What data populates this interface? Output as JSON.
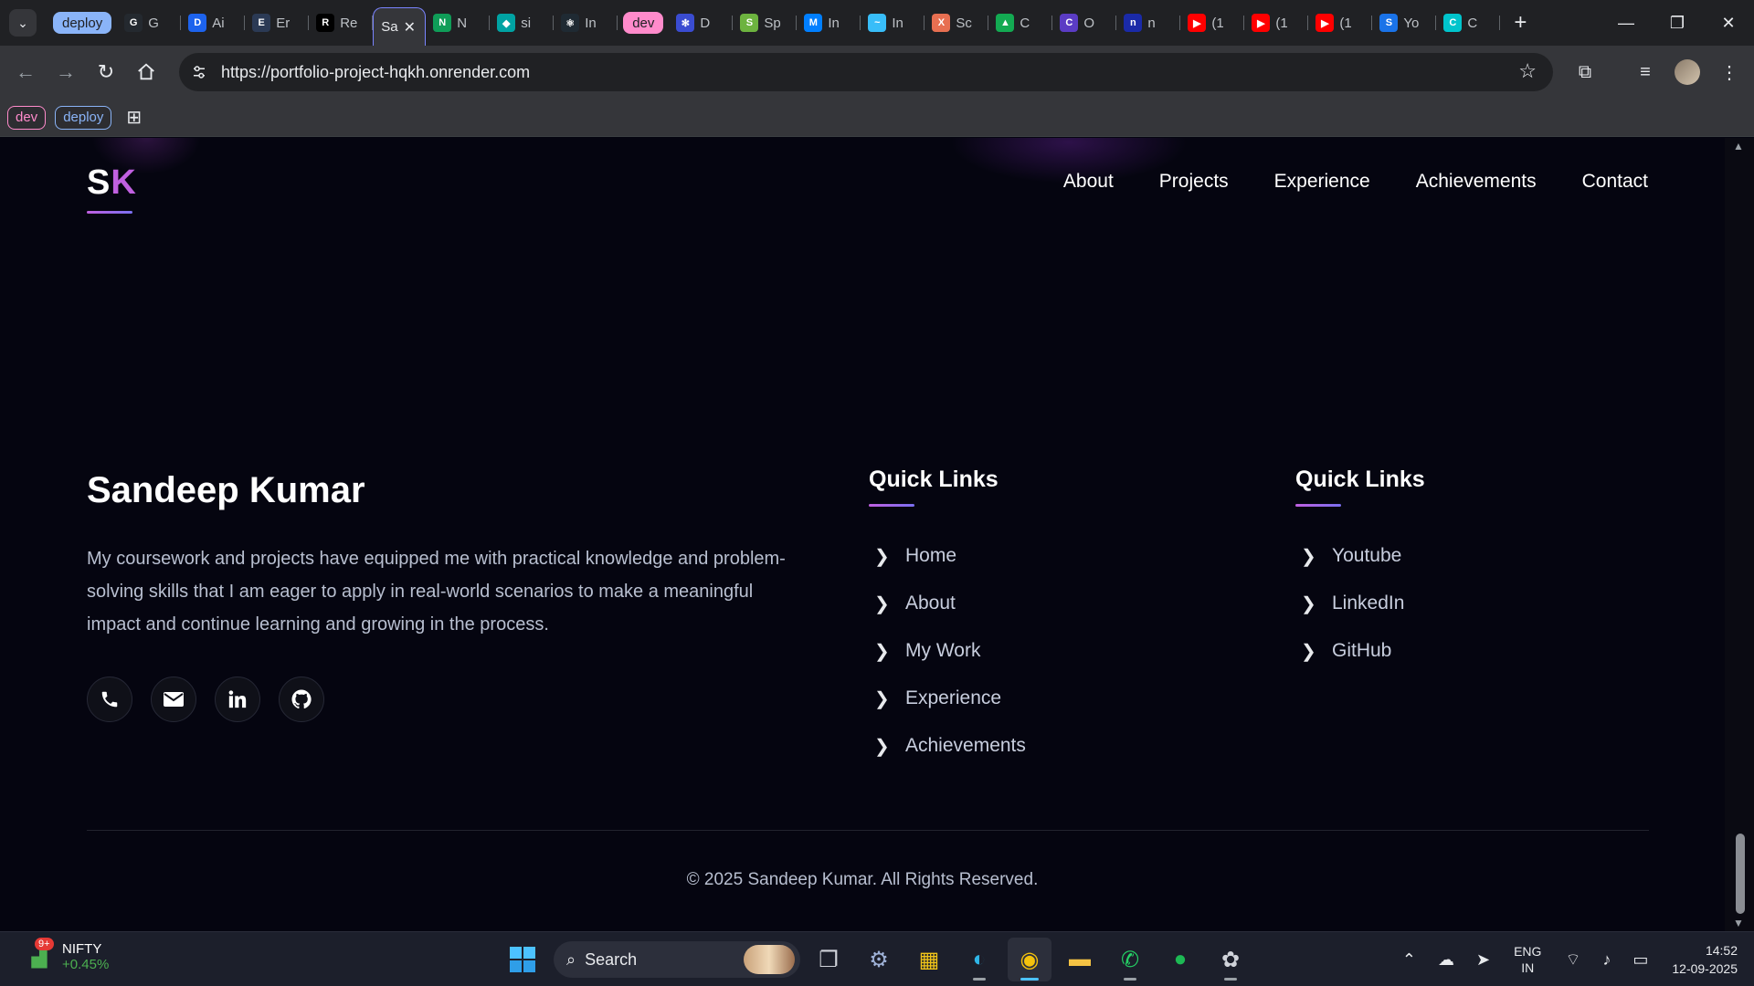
{
  "browser": {
    "tab_groups": [
      {
        "label": "deploy",
        "color": "#8ab4f8",
        "text_color": "#202124"
      },
      {
        "label": "dev",
        "color": "#ff8bcb",
        "text_color": "#202124"
      }
    ],
    "tabs_left": [
      {
        "icon": "github-icon",
        "glyph": "G",
        "bg": "#24292f",
        "title": "G"
      },
      {
        "icon": "docker-icon",
        "glyph": "D",
        "bg": "#1d63ed",
        "title": "Ai"
      },
      {
        "icon": "eraser-icon",
        "glyph": "E",
        "bg": "#2b3a55",
        "title": "Er"
      },
      {
        "icon": "render-icon",
        "glyph": "R",
        "bg": "#000000",
        "title": "Re"
      }
    ],
    "active_tab": {
      "icon": "portfolio-icon",
      "title": "Sa"
    },
    "tabs_after_active": [
      {
        "icon": "node-icon",
        "glyph": "N",
        "bg": "#0f9d58",
        "title": "N"
      },
      {
        "icon": "diamond-icon",
        "glyph": "◆",
        "bg": "#00a3a3",
        "title": "si"
      },
      {
        "icon": "react-icon",
        "glyph": "⚛",
        "bg": "#1f2a33",
        "title": "In"
      }
    ],
    "tabs_dev": [
      {
        "icon": "gear-icon",
        "glyph": "✻",
        "bg": "#3a4cd1",
        "title": "D"
      },
      {
        "icon": "spring-icon",
        "glyph": "S",
        "bg": "#6db33f",
        "title": "Sp"
      },
      {
        "icon": "mui-icon",
        "glyph": "M",
        "bg": "#007fff",
        "title": "In"
      },
      {
        "icon": "tailwind-icon",
        "glyph": "~",
        "bg": "#38bdf8",
        "title": "In"
      },
      {
        "icon": "framework-icon",
        "glyph": "X",
        "bg": "#e76f51",
        "title": "Sc"
      },
      {
        "icon": "mongo-icon",
        "glyph": "▲",
        "bg": "#13aa52",
        "title": "C"
      },
      {
        "icon": "claude-icon",
        "glyph": "C",
        "bg": "#5b3cc4",
        "title": "O"
      },
      {
        "icon": "n-icon",
        "glyph": "n",
        "bg": "#1a2aa8",
        "title": "n"
      }
    ],
    "tabs_right": [
      {
        "icon": "youtube-icon",
        "glyph": "▶",
        "bg": "#ff0000",
        "title": "(1"
      },
      {
        "icon": "youtube-icon",
        "glyph": "▶",
        "bg": "#ff0000",
        "title": "(1"
      },
      {
        "icon": "youtube-icon",
        "glyph": "▶",
        "bg": "#ff0000",
        "title": "(1"
      },
      {
        "icon": "s-icon",
        "glyph": "S",
        "bg": "#1a73e8",
        "title": "Yo"
      },
      {
        "icon": "canva-icon",
        "glyph": "C",
        "bg": "#00c4cc",
        "title": "C"
      }
    ],
    "url": "https://portfolio-project-hqkh.onrender.com",
    "bookmarks": [
      {
        "label": "dev",
        "color": "#ff8bcb"
      },
      {
        "label": "deploy",
        "color": "#8ab4f8"
      }
    ]
  },
  "site": {
    "logo_s": "S",
    "logo_k": "K",
    "nav": [
      "About",
      "Projects",
      "Experience",
      "Achievements",
      "Contact"
    ],
    "footer": {
      "name": "Sandeep Kumar",
      "description": "My coursework and projects have equipped me with practical knowledge and problem-solving skills that I am eager to apply in real-world scenarios to make a meaningful impact and continue learning and growing in the process.",
      "socials": [
        "phone-icon",
        "email-icon",
        "linkedin-icon",
        "github-icon"
      ],
      "col1": {
        "title": "Quick Links",
        "links": [
          "Home",
          "About",
          "My Work",
          "Experience",
          "Achievements"
        ]
      },
      "col2": {
        "title": "Quick Links",
        "links": [
          "Youtube",
          "LinkedIn",
          "GitHub"
        ]
      },
      "copyright": "© 2025 Sandeep Kumar. All Rights Reserved."
    },
    "accent": "#c060e0"
  },
  "taskbar": {
    "widget": {
      "name": "NIFTY",
      "value": "+0.45%",
      "badge": "9+"
    },
    "search_label": "Search",
    "language": {
      "line1": "ENG",
      "line2": "IN"
    },
    "time": "14:52",
    "date": "12-09-2025"
  }
}
